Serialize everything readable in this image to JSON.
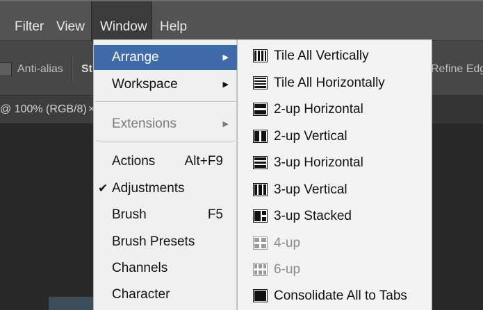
{
  "menubar": {
    "items": [
      "Filter",
      "View",
      "Window",
      "Help"
    ]
  },
  "options_bar": {
    "antialias_label": "Anti-alias",
    "style_label": "St",
    "refine_edge_label": "Refine Edge..."
  },
  "document_tab": {
    "title": "@ 100% (RGB/8)",
    "close_glyph": "×"
  },
  "window_menu": {
    "items": [
      {
        "label": "Arrange",
        "shortcut": "",
        "submenu": true,
        "highlighted": true,
        "disabled": false,
        "checked": false
      },
      {
        "label": "Workspace",
        "shortcut": "",
        "submenu": true,
        "highlighted": false,
        "disabled": false,
        "checked": false
      },
      {
        "label": "Extensions",
        "shortcut": "",
        "submenu": true,
        "highlighted": false,
        "disabled": true,
        "checked": false
      },
      {
        "label": "Actions",
        "shortcut": "Alt+F9",
        "submenu": false,
        "highlighted": false,
        "disabled": false,
        "checked": false
      },
      {
        "label": "Adjustments",
        "shortcut": "",
        "submenu": false,
        "highlighted": false,
        "disabled": false,
        "checked": true
      },
      {
        "label": "Brush",
        "shortcut": "F5",
        "submenu": false,
        "highlighted": false,
        "disabled": false,
        "checked": false
      },
      {
        "label": "Brush Presets",
        "shortcut": "",
        "submenu": false,
        "highlighted": false,
        "disabled": false,
        "checked": false
      },
      {
        "label": "Channels",
        "shortcut": "",
        "submenu": false,
        "highlighted": false,
        "disabled": false,
        "checked": false
      },
      {
        "label": "Character",
        "shortcut": "",
        "submenu": false,
        "highlighted": false,
        "disabled": false,
        "checked": false
      }
    ],
    "check_glyph": "✔",
    "submenu_arrow": "▶"
  },
  "arrange_submenu": {
    "items": [
      {
        "label": "Tile All Vertically",
        "icon": "tile-vertical-icon",
        "disabled": false
      },
      {
        "label": "Tile All Horizontally",
        "icon": "tile-horizontal-icon",
        "disabled": false
      },
      {
        "label": "2-up Horizontal",
        "icon": "two-up-horizontal-icon",
        "disabled": false
      },
      {
        "label": "2-up Vertical",
        "icon": "two-up-vertical-icon",
        "disabled": false
      },
      {
        "label": "3-up Horizontal",
        "icon": "three-up-horizontal-icon",
        "disabled": false
      },
      {
        "label": "3-up Vertical",
        "icon": "three-up-vertical-icon",
        "disabled": false
      },
      {
        "label": "3-up Stacked",
        "icon": "three-up-stacked-icon",
        "disabled": false
      },
      {
        "label": "4-up",
        "icon": "four-up-icon",
        "disabled": true
      },
      {
        "label": "6-up",
        "icon": "six-up-icon",
        "disabled": true
      },
      {
        "label": "Consolidate All to Tabs",
        "icon": "consolidate-tabs-icon",
        "disabled": false
      }
    ]
  },
  "colors": {
    "menu_highlight": "#3f6ba9",
    "menubar": "#535353",
    "workspace": "#282828"
  }
}
